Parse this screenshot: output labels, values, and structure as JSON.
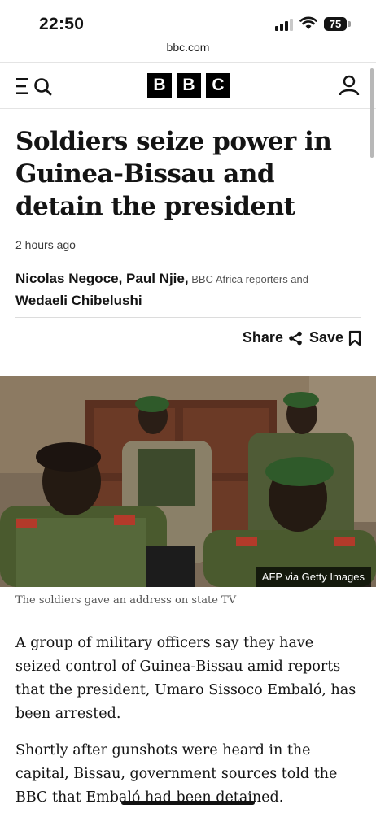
{
  "status_bar": {
    "time": "22:50",
    "battery": "75",
    "url": "bbc.com"
  },
  "header": {
    "logo_letters": [
      "B",
      "B",
      "C"
    ]
  },
  "article": {
    "headline": "Soldiers seize power in Guinea-Bissau and detain the president",
    "timestamp": "2 hours ago",
    "byline": {
      "authors_1": "Nicolas Negoce, Paul Njie,",
      "role_1": "BBC Africa reporters and",
      "author_2": "Wedaeli Chibelushi"
    },
    "share_label": "Share",
    "save_label": "Save",
    "image_credit": "AFP via Getty Images",
    "caption": "The soldiers gave an address on state TV",
    "paragraphs": [
      "A group of military officers say they have seized control of Guinea-Bissau amid reports that the president, Umaro Sissoco Embaló, has been arrested.",
      "Shortly after gunshots were heard in the capital, Bissau, government sources told the BBC that Embaló had been detained."
    ]
  },
  "colors": {
    "brand_black": "#000000",
    "text": "#141414",
    "muted": "#555555"
  }
}
